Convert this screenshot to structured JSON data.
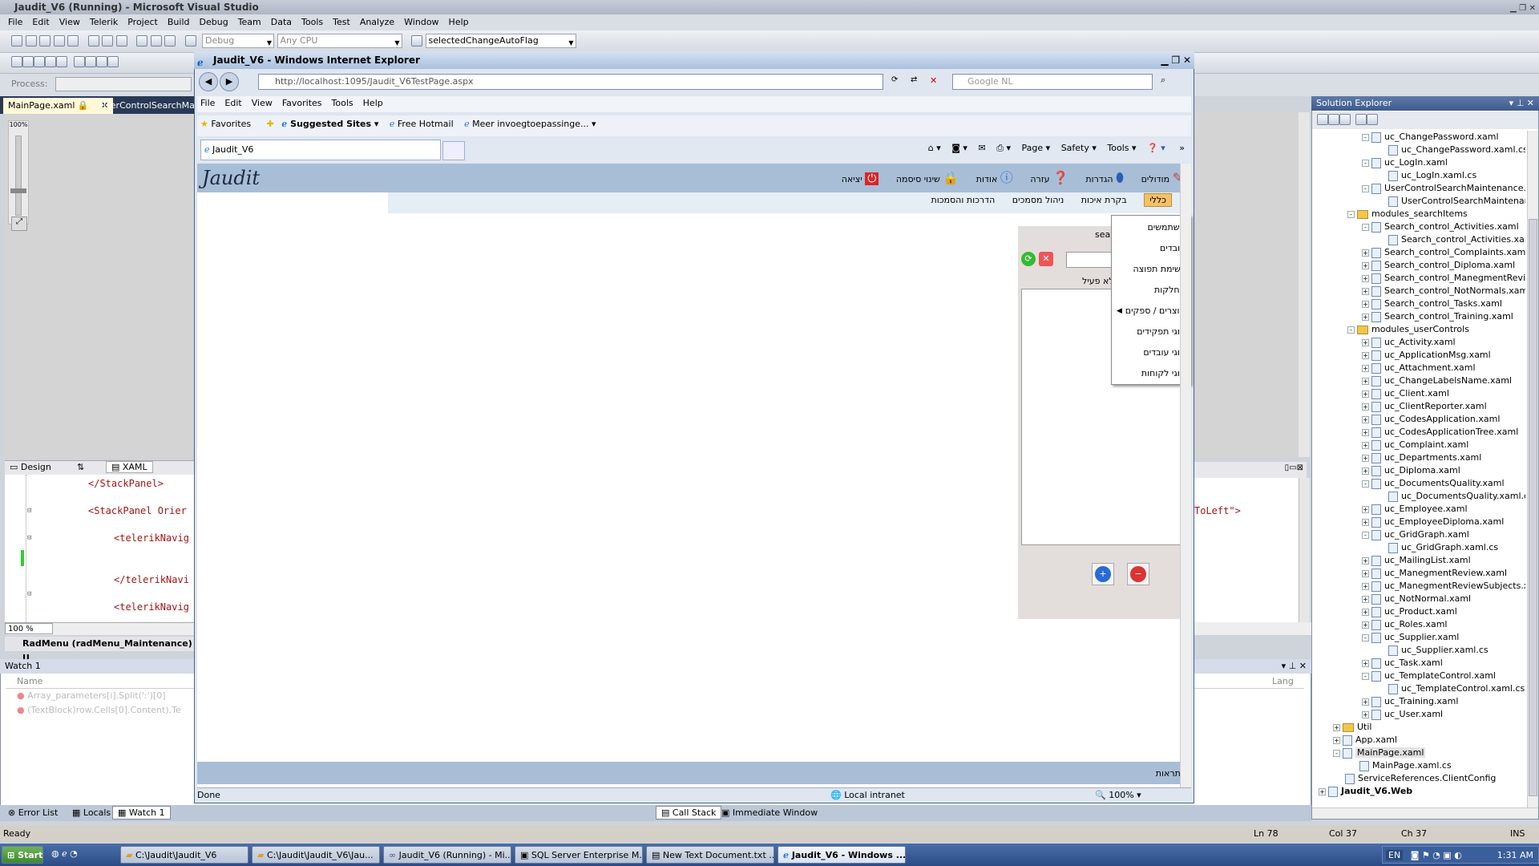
{
  "vs": {
    "title": "Jaudit_V6 (Running) - Microsoft Visual Studio",
    "menu": [
      "File",
      "Edit",
      "View",
      "Telerik",
      "Project",
      "Build",
      "Debug",
      "Team",
      "Data",
      "Tools",
      "Test",
      "Analyze",
      "Window",
      "Help"
    ],
    "config": "Debug",
    "platform": "Any CPU",
    "find": "selectedChangeAutoFlag",
    "process_label": "Process:",
    "tabs": [
      "MainPage.xaml",
      "UserControlSearchMaint"
    ],
    "zoom_ruler": "100%",
    "design_tab": "Design",
    "xaml_tab": "XAML",
    "code": [
      "</StackPanel>",
      "<StackPanel Orier",
      "<telerikNavig",
      "</telerikNavi",
      "<telerikNavig"
    ],
    "code_right": "ToLeft\">",
    "zoom": "100 %",
    "breadcrumb": "RadMenu (radMenu_Maintenance)",
    "breadcrumb_extra": "U",
    "watch": {
      "title": "Watch 1",
      "col_name": "Name",
      "col_lang": "Lang",
      "rows": [
        "Array_parameters[i].Split(':')[0]",
        "(TextBlock)row.Cells[0].Content).Te"
      ]
    },
    "bottom_tabs": [
      "Error List",
      "Locals",
      "Watch 1"
    ],
    "center_tabs": [
      "Call Stack",
      "Immediate Window"
    ],
    "status": {
      "ready": "Ready",
      "ln": "Ln 78",
      "col": "Col 37",
      "ch": "Ch 37",
      "ins": "INS"
    }
  },
  "ie": {
    "title": "Jaudit_V6 - Windows Internet Explorer",
    "url": "http://localhost:1095/Jaudit_V6TestPage.aspx",
    "search_placeholder": "Google NL",
    "menu": [
      "File",
      "Edit",
      "View",
      "Favorites",
      "Tools",
      "Help"
    ],
    "fav": "Favorites",
    "suggested": "Suggested Sites",
    "hotmail": "Free Hotmail",
    "more": "Meer invoegtoepassinge...",
    "tab": "Jaudit_V6",
    "cmd": [
      "Page",
      "Safety",
      "Tools"
    ],
    "status": "Done",
    "zone": "Local intranet",
    "zoom": "100%"
  },
  "jaudit": {
    "logo": "Jaudit",
    "nav": [
      "מודולים",
      "הגדרות",
      "עזרה",
      "אודות",
      "שינוי סיסמה",
      "יציאה"
    ],
    "sub": [
      "כללי",
      "בקרת איכות",
      "ניהול מסמכים",
      "הדרכות והסמכות"
    ],
    "menu": [
      "משתמשים",
      "עובדים",
      "רשימת תפוצה",
      "מחלקות",
      "מוצרים / ספקים",
      "סוגי תפקידים",
      "סוגי עובדים",
      "סוגי לקוחות"
    ],
    "panel_label": "sea",
    "inactive": "לא פעיל",
    "footer": "התראות"
  },
  "solution": {
    "title": "Solution Explorer",
    "items": [
      {
        "t": "uc_ChangePassword.xaml",
        "l": 4,
        "k": "f",
        "e": "-"
      },
      {
        "t": "uc_ChangePassword.xaml.cs",
        "l": 5,
        "k": "f"
      },
      {
        "t": "uc_LogIn.xaml",
        "l": 4,
        "k": "f",
        "e": "-"
      },
      {
        "t": "uc_LogIn.xaml.cs",
        "l": 5,
        "k": "f"
      },
      {
        "t": "UserControlSearchMaintenance.xar",
        "l": 4,
        "k": "f",
        "e": "-"
      },
      {
        "t": "UserControlSearchMaintenance",
        "l": 5,
        "k": "f"
      },
      {
        "t": "modules_searchItems",
        "l": 3,
        "k": "d",
        "e": "-"
      },
      {
        "t": "Search_control_Activities.xaml",
        "l": 4,
        "k": "f",
        "e": "-"
      },
      {
        "t": "Search_control_Activities.xaml.",
        "l": 5,
        "k": "f"
      },
      {
        "t": "Search_control_Complaints.xaml",
        "l": 4,
        "k": "f",
        "e": "+"
      },
      {
        "t": "Search_control_Diploma.xaml",
        "l": 4,
        "k": "f",
        "e": "+"
      },
      {
        "t": "Search_control_ManegmentReview",
        "l": 4,
        "k": "f",
        "e": "+"
      },
      {
        "t": "Search_control_NotNormals.xaml",
        "l": 4,
        "k": "f",
        "e": "+"
      },
      {
        "t": "Search_control_Tasks.xaml",
        "l": 4,
        "k": "f",
        "e": "+"
      },
      {
        "t": "Search_control_Training.xaml",
        "l": 4,
        "k": "f",
        "e": "+"
      },
      {
        "t": "modules_userControls",
        "l": 3,
        "k": "d",
        "e": "-"
      },
      {
        "t": "uc_Activity.xaml",
        "l": 4,
        "k": "f",
        "e": "+"
      },
      {
        "t": "uc_ApplicationMsg.xaml",
        "l": 4,
        "k": "f",
        "e": "+"
      },
      {
        "t": "uc_Attachment.xaml",
        "l": 4,
        "k": "f",
        "e": "+"
      },
      {
        "t": "uc_ChangeLabelsName.xaml",
        "l": 4,
        "k": "f",
        "e": "+"
      },
      {
        "t": "uc_Client.xaml",
        "l": 4,
        "k": "f",
        "e": "+"
      },
      {
        "t": "uc_ClientReporter.xaml",
        "l": 4,
        "k": "f",
        "e": "+"
      },
      {
        "t": "uc_CodesApplication.xaml",
        "l": 4,
        "k": "f",
        "e": "+"
      },
      {
        "t": "uc_CodesApplicationTree.xaml",
        "l": 4,
        "k": "f",
        "e": "+"
      },
      {
        "t": "uc_Complaint.xaml",
        "l": 4,
        "k": "f",
        "e": "+"
      },
      {
        "t": "uc_Departments.xaml",
        "l": 4,
        "k": "f",
        "e": "+"
      },
      {
        "t": "uc_Diploma.xaml",
        "l": 4,
        "k": "f",
        "e": "+"
      },
      {
        "t": "uc_DocumentsQuality.xaml",
        "l": 4,
        "k": "f",
        "e": "-"
      },
      {
        "t": "uc_DocumentsQuality.xaml.cs",
        "l": 5,
        "k": "f"
      },
      {
        "t": "uc_Employee.xaml",
        "l": 4,
        "k": "f",
        "e": "+"
      },
      {
        "t": "uc_EmployeeDiploma.xaml",
        "l": 4,
        "k": "f",
        "e": "+"
      },
      {
        "t": "uc_GridGraph.xaml",
        "l": 4,
        "k": "f",
        "e": "-"
      },
      {
        "t": "uc_GridGraph.xaml.cs",
        "l": 5,
        "k": "f"
      },
      {
        "t": "uc_MailingList.xaml",
        "l": 4,
        "k": "f",
        "e": "+"
      },
      {
        "t": "uc_ManegmentReview.xaml",
        "l": 4,
        "k": "f",
        "e": "+"
      },
      {
        "t": "uc_ManegmentReviewSubjects.xam",
        "l": 4,
        "k": "f",
        "e": "+"
      },
      {
        "t": "uc_NotNormal.xaml",
        "l": 4,
        "k": "f",
        "e": "+"
      },
      {
        "t": "uc_Product.xaml",
        "l": 4,
        "k": "f",
        "e": "+"
      },
      {
        "t": "uc_Roles.xaml",
        "l": 4,
        "k": "f",
        "e": "+"
      },
      {
        "t": "uc_Supplier.xaml",
        "l": 4,
        "k": "f",
        "e": "-"
      },
      {
        "t": "uc_Supplier.xaml.cs",
        "l": 5,
        "k": "f"
      },
      {
        "t": "uc_Task.xaml",
        "l": 4,
        "k": "f",
        "e": "+"
      },
      {
        "t": "uc_TemplateControl.xaml",
        "l": 4,
        "k": "f",
        "e": "-"
      },
      {
        "t": "uc_TemplateControl.xaml.cs",
        "l": 5,
        "k": "f"
      },
      {
        "t": "uc_Training.xaml",
        "l": 4,
        "k": "f",
        "e": "+"
      },
      {
        "t": "uc_User.xaml",
        "l": 4,
        "k": "f",
        "e": "+"
      },
      {
        "t": "Util",
        "l": 2,
        "k": "d",
        "e": "+"
      },
      {
        "t": "App.xaml",
        "l": 2,
        "k": "f",
        "e": "+"
      },
      {
        "t": "MainPage.xaml",
        "l": 2,
        "k": "f",
        "e": "-"
      },
      {
        "t": "MainPage.xaml.cs",
        "l": 3,
        "k": "f"
      },
      {
        "t": "ServiceReferences.ClientConfig",
        "l": 2,
        "k": "f"
      },
      {
        "t": "Jaudit_V6.Web",
        "l": 1,
        "k": "p",
        "e": "+"
      }
    ]
  },
  "taskbar": {
    "start": "Start",
    "items": [
      "C:\\Jaudit\\Jaudit_V6",
      "C:\\Jaudit\\Jaudit_V6\\Jau...",
      "Jaudit_V6 (Running) - Mi...",
      "SQL Server Enterprise M...",
      "New Text Document.txt ...",
      "Jaudit_V6 - Windows ..."
    ],
    "lang": "EN",
    "time": "1:31 AM"
  }
}
